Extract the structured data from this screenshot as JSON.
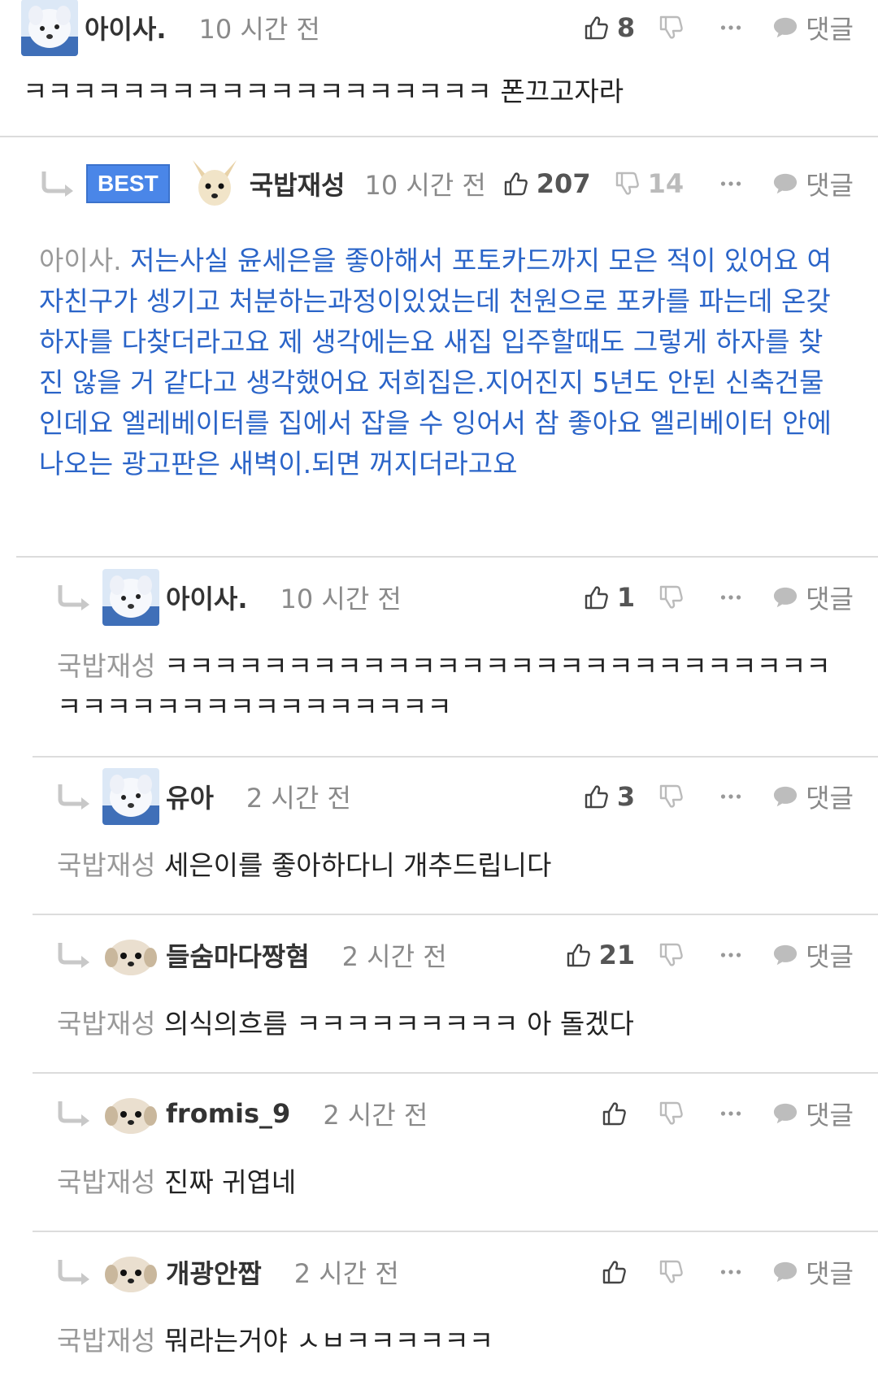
{
  "labels": {
    "reply": "댓글",
    "best": "BEST"
  },
  "comments": [
    {
      "author": "아이사.",
      "time": "10 시간 전",
      "likes": "8",
      "dislikes": "",
      "mention": "",
      "text": "ㅋㅋㅋㅋㅋㅋㅋㅋㅋㅋㅋㅋㅋㅋㅋㅋㅋㅋㅋ 폰끄고자라",
      "avatar": "white-dog-avatar"
    },
    {
      "author": "국밥재성",
      "time": "10 시간 전",
      "likes": "207",
      "dislikes": "14",
      "mention": "아이사.",
      "text": "저는사실 윤세은을 좋아해서 포토카드까지 모은 적이 있어요 여자친구가 셍기고 처분하는과정이있었는데 천원으로 포카를 파는데 온갖 하자를 다찾더라고요 제 생각에는요 새집 입주할때도 그렇게 하자를 찾진 않을 거 같다고 생각했어요 저희집은.지어진지 5년도 안된 신축건물인데요 엘레베이터를 집에서 잡을 수 잉어서 참 좋아요 엘리베이터 안에 나오는 광고판은 새벽이.되면 꺼지더라고요",
      "best": true,
      "avatar": "chihuahua-avatar"
    },
    {
      "author": "아이사.",
      "time": "10 시간 전",
      "likes": "1",
      "dislikes": "",
      "mention": "국밥재성",
      "text": "ㅋㅋㅋㅋㅋㅋㅋㅋㅋㅋㅋㅋㅋㅋㅋㅋㅋㅋㅋㅋㅋㅋㅋㅋㅋㅋㅋㅋㅋㅋㅋㅋㅋㅋㅋㅋㅋㅋㅋㅋㅋㅋㅋ",
      "avatar": "white-dog-avatar"
    },
    {
      "author": "유아",
      "time": "2 시간 전",
      "likes": "3",
      "dislikes": "",
      "mention": "국밥재성",
      "text": "세은이를 좋아하다니 개추드립니다",
      "avatar": "white-dog-avatar"
    },
    {
      "author": "들숨마다짱혐",
      "time": "2 시간 전",
      "likes": "21",
      "dislikes": "",
      "mention": "국밥재성",
      "text": "의식의흐름 ㅋㅋㅋㅋㅋㅋㅋㅋㅋ 아 돌겠다",
      "avatar": "puppy-avatar"
    },
    {
      "author": "fromis_9",
      "time": "2 시간 전",
      "likes": "",
      "dislikes": "",
      "mention": "국밥재성",
      "text": "진짜 귀엽네",
      "avatar": "puppy-avatar"
    },
    {
      "author": "개광안짭",
      "time": "2 시간 전",
      "likes": "",
      "dislikes": "",
      "mention": "국밥재성",
      "text": "뭐라는거야 ㅅㅂㅋㅋㅋㅋㅋㅋ",
      "avatar": "puppy-avatar"
    }
  ]
}
